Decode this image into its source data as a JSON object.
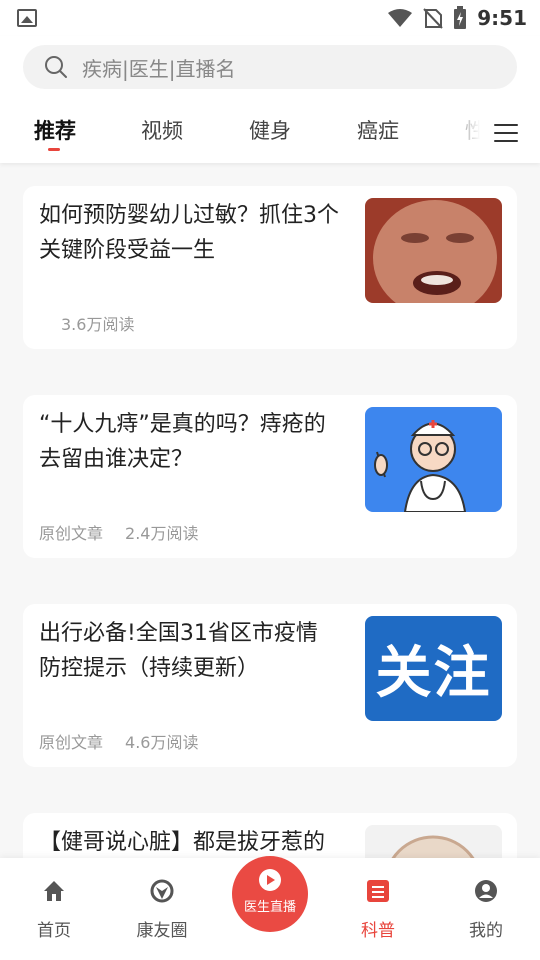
{
  "status_bar": {
    "time": "9:51"
  },
  "search": {
    "placeholder": "疾病|医生|直播名"
  },
  "tabs": [
    {
      "label": "推荐",
      "active": true
    },
    {
      "label": "视频",
      "active": false
    },
    {
      "label": "健身",
      "active": false
    },
    {
      "label": "癌症",
      "active": false
    },
    {
      "label": "性",
      "active": false
    }
  ],
  "articles": [
    {
      "title": "如何预防婴幼儿过敏？抓住3个关键阶段受益一生",
      "source": "",
      "reads": "3.6万阅读",
      "thumb": "crying-baby"
    },
    {
      "title": "“十人九痔”是真的吗？痔疮的去留由谁决定？",
      "source": "原创文章",
      "reads": "2.4万阅读",
      "thumb": "doctor-cartoon"
    },
    {
      "title": "出行必备!全国31省区市疫情防控提示（持续更新）",
      "source": "原创文章",
      "reads": "4.6万阅读",
      "thumb_text": "关注"
    },
    {
      "title": "【健哥说心脏】都是拔牙惹的",
      "source": "",
      "reads": "",
      "thumb": "heart-illustration"
    }
  ],
  "bottom_nav": {
    "home": "首页",
    "community": "康友圈",
    "live": "医生直播",
    "science": "科普",
    "mine": "我的",
    "active": "science"
  },
  "colors": {
    "accent": "#e8453c",
    "live_button": "#ea4a43",
    "thumb_blue": "#1f6bc4"
  }
}
